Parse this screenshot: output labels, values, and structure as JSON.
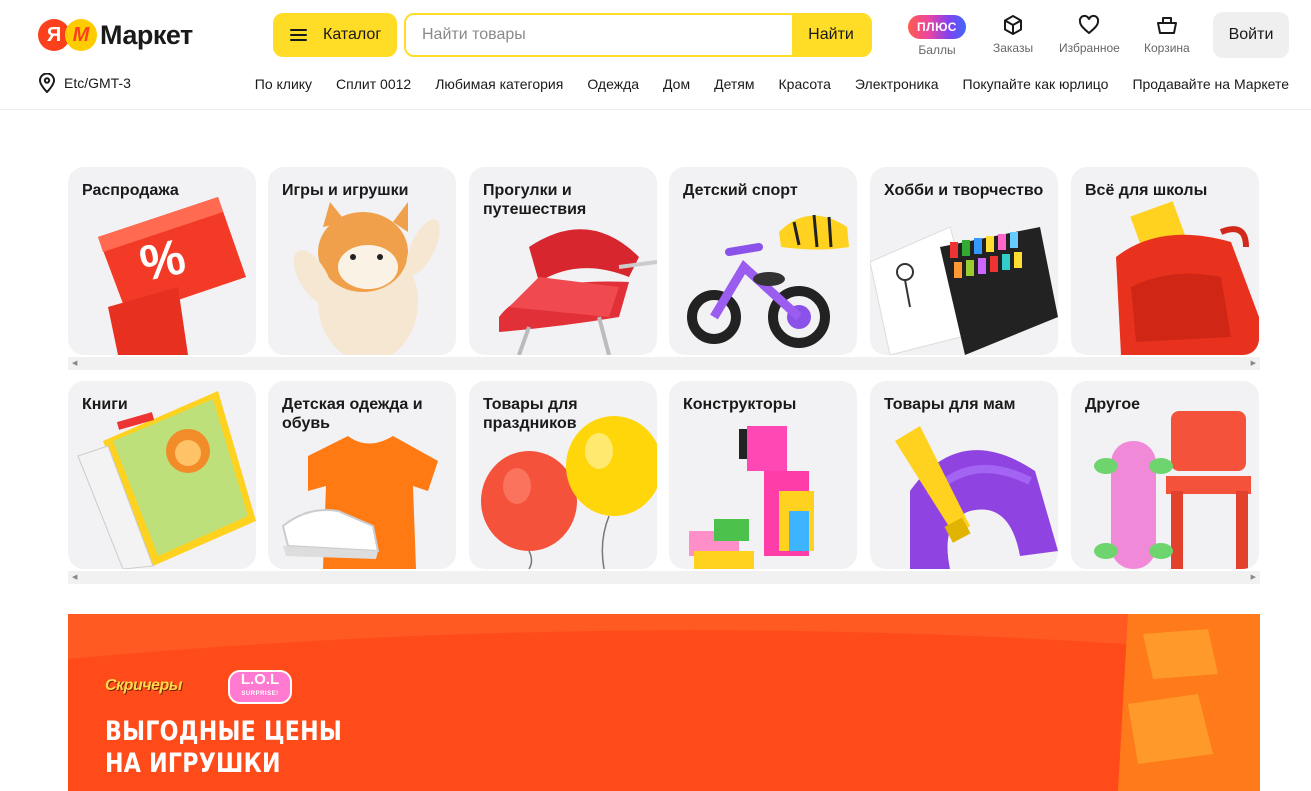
{
  "header": {
    "logo_text": "Маркет",
    "logo_ya": "Я",
    "catalog_label": "Каталог",
    "search_placeholder": "Найти товары",
    "search_button": "Найти",
    "plus_badge": "ПЛЮС",
    "points_label": "Баллы",
    "orders_label": "Заказы",
    "favorites_label": "Избранное",
    "cart_label": "Корзина",
    "login_label": "Войти"
  },
  "location": {
    "label": "Etc/GMT-3"
  },
  "nav": [
    "По клику",
    "Сплит 0012",
    "Любимая категория",
    "Одежда",
    "Дом",
    "Детям",
    "Красота",
    "Электроника",
    "Покупайте как юрлицо",
    "Продавайте на Маркете"
  ],
  "categories_row1": [
    "Распродажа",
    "Игры и игрушки",
    "Прогулки и путешествия",
    "Детский спорт",
    "Хобби и творчество",
    "Всё для школы"
  ],
  "categories_row2": [
    "Книги",
    "Детская одежда и обувь",
    "Товары для праздников",
    "Конструкторы",
    "Товары для мам",
    "Другое"
  ],
  "banner": {
    "title": "ВЫГОДНЫЕ ЦЕНЫ\nНА ИГРУШКИ",
    "brand1": "Скричеры",
    "brand2": "L.O.L",
    "brand2_sub": "SURPRISE!"
  },
  "colors": {
    "accent": "#ffdc25",
    "brand_red": "#fc3f1d",
    "banner_bg": "#ff4b1a",
    "card_bg": "#f2f1f3"
  }
}
